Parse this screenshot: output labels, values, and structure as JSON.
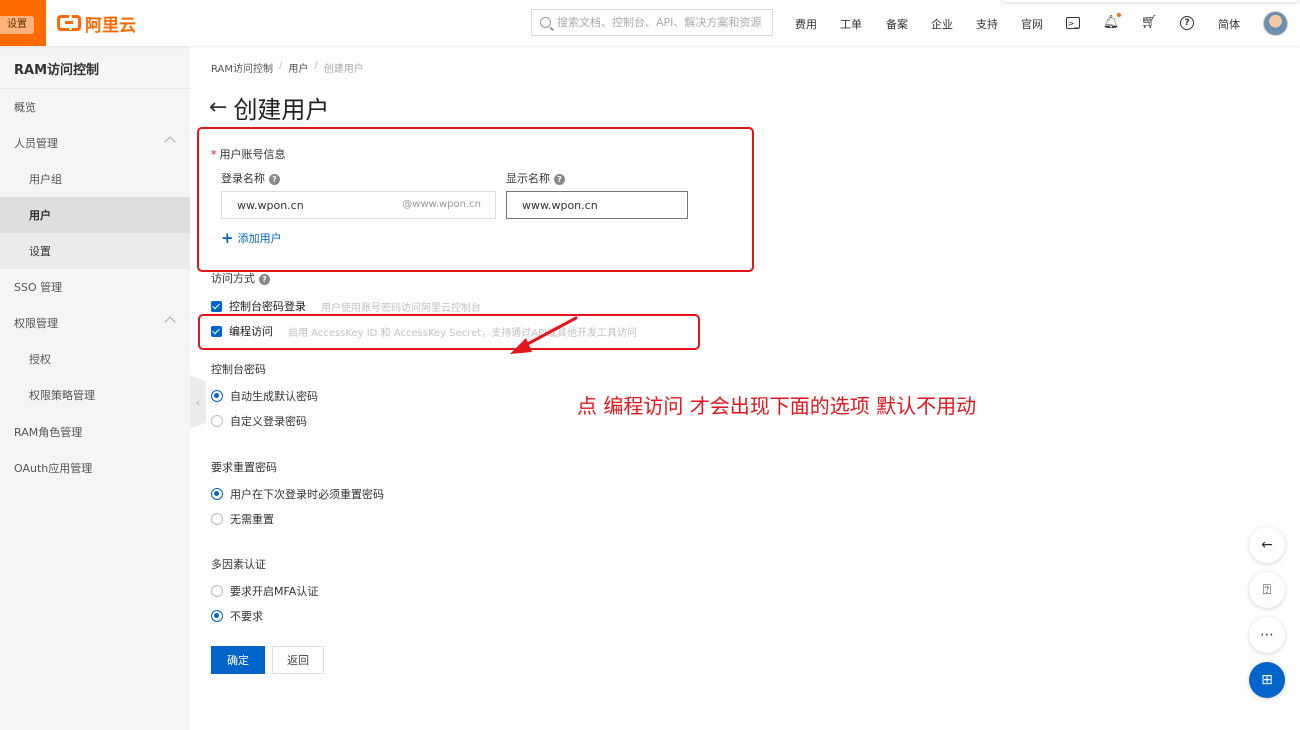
{
  "header": {
    "settings_tag": "设置",
    "logo_text": "阿里云",
    "search_placeholder": "搜索文档、控制台、API、解决方案和资源",
    "nav": [
      "费用",
      "工单",
      "备案",
      "企业",
      "支持",
      "官网"
    ],
    "language": "简体",
    "icons": [
      "terminal-icon",
      "bell-icon",
      "cart-icon",
      "help-icon"
    ],
    "notification_dot_color": "#ff6a00",
    "brand_color": "#ff6a00"
  },
  "sidebar": {
    "title": "RAM访问控制",
    "items": [
      {
        "label": "概览",
        "level": 1
      },
      {
        "label": "人员管理",
        "level": 1,
        "expanded": true
      },
      {
        "label": "用户组",
        "level": 2
      },
      {
        "label": "用户",
        "level": 2,
        "active": true
      },
      {
        "label": "设置",
        "level": 2
      },
      {
        "label": "SSO 管理",
        "level": 1
      },
      {
        "label": "权限管理",
        "level": 1,
        "expanded": true
      },
      {
        "label": "授权",
        "level": 2
      },
      {
        "label": "权限策略管理",
        "level": 2
      },
      {
        "label": "RAM角色管理",
        "level": 1
      },
      {
        "label": "OAuth应用管理",
        "level": 1
      }
    ]
  },
  "breadcrumb": [
    "RAM访问控制",
    "用户",
    "创建用户"
  ],
  "page_title": "创建用户",
  "form": {
    "account_section": "用户账号信息",
    "login_name_label": "登录名称",
    "login_name_value": "ww.wpon.cn",
    "login_name_suffix": "@www.wpon.cn",
    "display_name_label": "显示名称",
    "display_name_value": "www.wpon.cn",
    "add_user": "添加用户",
    "access_mode_label": "访问方式",
    "access_options": [
      {
        "label": "控制台密码登录",
        "hint": "用户使用账号密码访问阿里云控制台",
        "checked": true
      },
      {
        "label": "编程访问",
        "hint": "启用 AccessKey ID 和 AccessKey Secret，支持通过API或其他开发工具访问",
        "checked": true
      }
    ],
    "console_password_label": "控制台密码",
    "console_password_options": [
      {
        "label": "自动生成默认密码",
        "selected": true
      },
      {
        "label": "自定义登录密码",
        "selected": false
      }
    ],
    "reset_password_label": "要求重置密码",
    "reset_password_options": [
      {
        "label": "用户在下次登录时必须重置密码",
        "selected": true
      },
      {
        "label": "无需重置",
        "selected": false
      }
    ],
    "mfa_label": "多因素认证",
    "mfa_options": [
      {
        "label": "要求开启MFA认证",
        "selected": false
      },
      {
        "label": "不要求",
        "selected": true
      }
    ],
    "confirm_button": "确定",
    "back_button": "返回"
  },
  "annotation_text": "点 编程访问 才会出现下面的选项 默认不用动",
  "annotation_color": "#e5161b",
  "floating_tools": [
    "collapse-panel-icon",
    "doc-question-icon",
    "chat-icon",
    "apps-icon"
  ],
  "primary_color": "#0064c8"
}
